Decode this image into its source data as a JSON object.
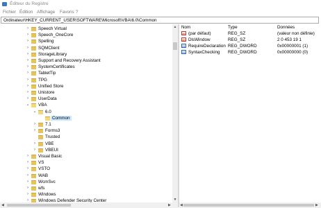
{
  "window": {
    "title": "Éditeur du Registre"
  },
  "menu": {
    "items": [
      "Fichier",
      "Édition",
      "Affichage",
      "Favoris",
      "?"
    ]
  },
  "address": {
    "path": "Ordinateur\\HKEY_CURRENT_USER\\SOFTWARE\\Microsoft\\VBA\\6.0\\Common"
  },
  "tree": {
    "items": [
      {
        "label": "Speech Virtual",
        "level": 0,
        "chevron": "right"
      },
      {
        "label": "Speech_OneCore",
        "level": 0,
        "chevron": "right"
      },
      {
        "label": "Spelling",
        "level": 0,
        "chevron": "right"
      },
      {
        "label": "SQMClient",
        "level": 0,
        "chevron": "right"
      },
      {
        "label": "StorageLibrary",
        "level": 0,
        "chevron": "right"
      },
      {
        "label": "Support and Recovery Assistant",
        "level": 0,
        "chevron": "right"
      },
      {
        "label": "SystemCertificates",
        "level": 0,
        "chevron": "right"
      },
      {
        "label": "TabletTip",
        "level": 0,
        "chevron": "right"
      },
      {
        "label": "TPG",
        "level": 0,
        "chevron": "right"
      },
      {
        "label": "Unified Store",
        "level": 0,
        "chevron": "right"
      },
      {
        "label": "Unistore",
        "level": 0,
        "chevron": "right"
      },
      {
        "label": "UserData",
        "level": 0,
        "chevron": "right"
      },
      {
        "label": "VBA",
        "level": 0,
        "chevron": "down"
      },
      {
        "label": "6.0",
        "level": 1,
        "chevron": "down"
      },
      {
        "label": "Common",
        "level": 2,
        "chevron": "none",
        "selected": true
      },
      {
        "label": "7.1",
        "level": 1,
        "chevron": "right"
      },
      {
        "label": "Forms3",
        "level": 1,
        "chevron": "right"
      },
      {
        "label": "Trusted",
        "level": 1,
        "chevron": "none"
      },
      {
        "label": "VBE",
        "level": 1,
        "chevron": "right"
      },
      {
        "label": "VBEUI",
        "level": 1,
        "chevron": "right"
      },
      {
        "label": "Visual Basic",
        "level": 0,
        "chevron": "right"
      },
      {
        "label": "VS",
        "level": 0,
        "chevron": "right"
      },
      {
        "label": "VSTO",
        "level": 0,
        "chevron": "right"
      },
      {
        "label": "WAB",
        "level": 0,
        "chevron": "right"
      },
      {
        "label": "WcmSvc",
        "level": 0,
        "chevron": "right"
      },
      {
        "label": "wfs",
        "level": 0,
        "chevron": "right"
      },
      {
        "label": "Windows",
        "level": 0,
        "chevron": "right"
      },
      {
        "label": "Windows Defender Security Center",
        "level": 0,
        "chevron": "right"
      }
    ]
  },
  "values": {
    "headers": {
      "name": "Nom",
      "type": "Type",
      "data": "Données"
    },
    "rows": [
      {
        "name": "(par défaut)",
        "type": "REG_SZ",
        "data": "(valeur non définie)",
        "icon": "string-value-icon"
      },
      {
        "name": "DlsWindow",
        "type": "REG_SZ",
        "data": "2 0 453 19 1",
        "icon": "string-value-icon"
      },
      {
        "name": "RequireDeclaration",
        "type": "REG_DWORD",
        "data": "0x00000001 (1)",
        "icon": "dword-value-icon"
      },
      {
        "name": "SyntaxChecking",
        "type": "REG_DWORD",
        "data": "0x00000000 (0)",
        "icon": "dword-value-icon"
      }
    ]
  }
}
